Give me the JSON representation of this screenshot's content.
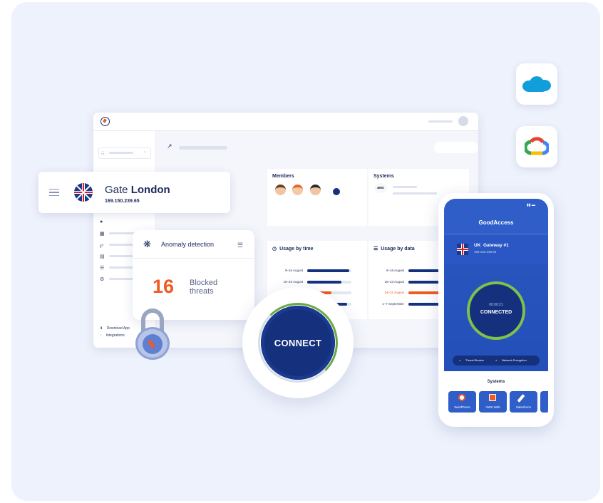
{
  "gate": {
    "prefix": "Gate",
    "city": "London",
    "ip": "169.150.239.65"
  },
  "anomaly": {
    "title": "Anomaly detection",
    "count": "16",
    "line1": "Blocked",
    "line2": "threats"
  },
  "connect_label": "CONNECT",
  "sidebar": {
    "download": "Download App",
    "integrations": "Integrations"
  },
  "members": {
    "title": "Members"
  },
  "systems_panel": {
    "title": "Systems",
    "logo": "aws"
  },
  "usage_time": {
    "title": "Usage by time",
    "rows": [
      {
        "label": "9–16 August",
        "value": 0.95,
        "color": "#15317e"
      },
      {
        "label": "16–23 August",
        "value": 0.78,
        "color": "#15317e"
      },
      {
        "label": "24–31 August",
        "value": 0.55,
        "color": "#f05a23"
      },
      {
        "label": "1–7 September",
        "value": 0.9,
        "color": "#15317e"
      }
    ]
  },
  "usage_data": {
    "title": "Usage by data",
    "rows": [
      {
        "label": "9–16 August",
        "value": 0.95,
        "color": "#15317e"
      },
      {
        "label": "16–23 August",
        "value": 0.72,
        "color": "#15317e"
      },
      {
        "label": "24–31 August",
        "value": 0.9,
        "color": "#f05a23"
      },
      {
        "label": "1–7 September",
        "value": 0.95,
        "color": "#15317e"
      }
    ]
  },
  "phone": {
    "app_title": "GoodAccess",
    "gateway": "UK  Gateway #1",
    "gateway_ip": "169.150.239.65",
    "timer": "00:00:21",
    "status": "CONNECTED",
    "features": [
      "Threat Blocker",
      "Network Encryption"
    ],
    "systems_title": "Systems",
    "systems": [
      "WordPress",
      "AWS Web",
      "Salesforce"
    ]
  },
  "colors": {
    "navy": "#15317e",
    "orange": "#f05a23",
    "bg": "#eef2fc",
    "phone_blue": "#2f5ec9"
  }
}
